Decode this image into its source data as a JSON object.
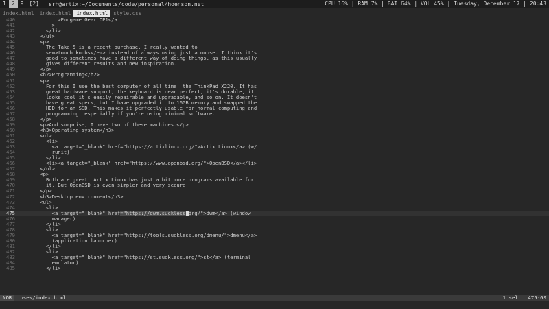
{
  "wm": {
    "workspaces": [
      "1",
      "2",
      "9",
      "[2]"
    ],
    "active_workspace_index": 1,
    "window_title": "srh@artix:~/Documents/code/personal/hoenson.net",
    "status": {
      "cpu": "CPU 16%",
      "ram": "RAM 7%",
      "bat": "BAT 64%",
      "vol": "VOL 45%",
      "date": "Tuesday, December 17",
      "time": "20:43"
    }
  },
  "tabs": [
    {
      "label": "index.html",
      "active": false
    },
    {
      "label": "index.html",
      "active": false
    },
    {
      "label": "index.html",
      "active": true
    },
    {
      "label": "style.css",
      "active": false
    }
  ],
  "editor": {
    "current_line": 475,
    "lines": [
      {
        "n": "440",
        "t": "          >Endgame Gear OP1</a"
      },
      {
        "n": "441",
        "t": "        >"
      },
      {
        "n": "442",
        "t": "      </li>"
      },
      {
        "n": "443",
        "t": "    </ul>"
      },
      {
        "n": "444",
        "t": "    <p>"
      },
      {
        "n": "445",
        "t": "      The Take 5 is a recent purchase. I really wanted to"
      },
      {
        "n": "446",
        "t": "      <em>touch knobs</em> instead of always using just a mouse. I think it's"
      },
      {
        "n": "447",
        "t": "      good to sometimes have a different way of doing things, as this usually"
      },
      {
        "n": "448",
        "t": "      gives different results and new inspiration."
      },
      {
        "n": "449",
        "t": "    </p>"
      },
      {
        "n": "450",
        "t": "    <h2>Programming</h2>"
      },
      {
        "n": "451",
        "t": "    <p>"
      },
      {
        "n": "452",
        "t": "      For this I use the best computer of all time: the ThinkPad X220. It has"
      },
      {
        "n": "453",
        "t": "      great hardware support, the keyboard is near perfect, it's durable, it"
      },
      {
        "n": "454",
        "t": "      looks cool it's easily repairable and upgradable, and so on. It doesn't"
      },
      {
        "n": "455",
        "t": "      have great specs, but I have upgraded it to 16GB memory and swapped the"
      },
      {
        "n": "456",
        "t": "      HDD for an SSD. This makes it perfectly usable for normal computing and"
      },
      {
        "n": "457",
        "t": "      programming, especially if you're using minimal software."
      },
      {
        "n": "458",
        "t": "    </p>"
      },
      {
        "n": "459",
        "t": "    <p>And surprise, I have two of these machines.</p>"
      },
      {
        "n": "460",
        "t": "    <h3>Operating system</h3>"
      },
      {
        "n": "461",
        "t": "    <ul>"
      },
      {
        "n": "462",
        "t": "      <li>"
      },
      {
        "n": "463",
        "t": "        <a target=\"_blank\" href=\"https://artixlinux.org/\">Artix Linux</a> (w/"
      },
      {
        "n": "464",
        "t": "        runit)"
      },
      {
        "n": "465",
        "t": "      </li>"
      },
      {
        "n": "466",
        "t": "      <li><a target=\"_blank\" href=\"https://www.openbsd.org/\">OpenBSD</a></li>"
      },
      {
        "n": "467",
        "t": "    </ul>"
      },
      {
        "n": "468",
        "t": "    <p>"
      },
      {
        "n": "469",
        "t": "      Both are great. Artix Linux has just a bit more programs available for"
      },
      {
        "n": "470",
        "t": "      it. But OpenBSD is even simpler and very secure."
      },
      {
        "n": "471",
        "t": "    </p>"
      },
      {
        "n": "472",
        "t": "    <h3>Desktop environment</h3>"
      },
      {
        "n": "473",
        "t": "    <ul>"
      },
      {
        "n": "474",
        "t": "      <li>"
      },
      {
        "n": "475",
        "t": "        <a target=\"_blank\" href=\"https://dwm.suckless.org/\">dwm</a> (window"
      },
      {
        "n": "476",
        "t": "        manager)"
      },
      {
        "n": "477",
        "t": "      </li>"
      },
      {
        "n": "478",
        "t": "      <li>"
      },
      {
        "n": "479",
        "t": "        <a target=\"_blank\" href=\"https://tools.suckless.org/dmenu/\">dmenu</a>"
      },
      {
        "n": "480",
        "t": "        (application launcher)"
      },
      {
        "n": "481",
        "t": "      </li>"
      },
      {
        "n": "482",
        "t": "      <li>"
      },
      {
        "n": "483",
        "t": "        <a target=\"_blank\" href=\"https://st.suckless.org/\">st</a> (terminal"
      },
      {
        "n": "484",
        "t": "        emulator)"
      },
      {
        "n": "485",
        "t": "      </li>"
      }
    ]
  },
  "statusline": {
    "mode": "NOR",
    "file": "uses/index.html",
    "selection": "1 sel",
    "position": "475:60"
  }
}
